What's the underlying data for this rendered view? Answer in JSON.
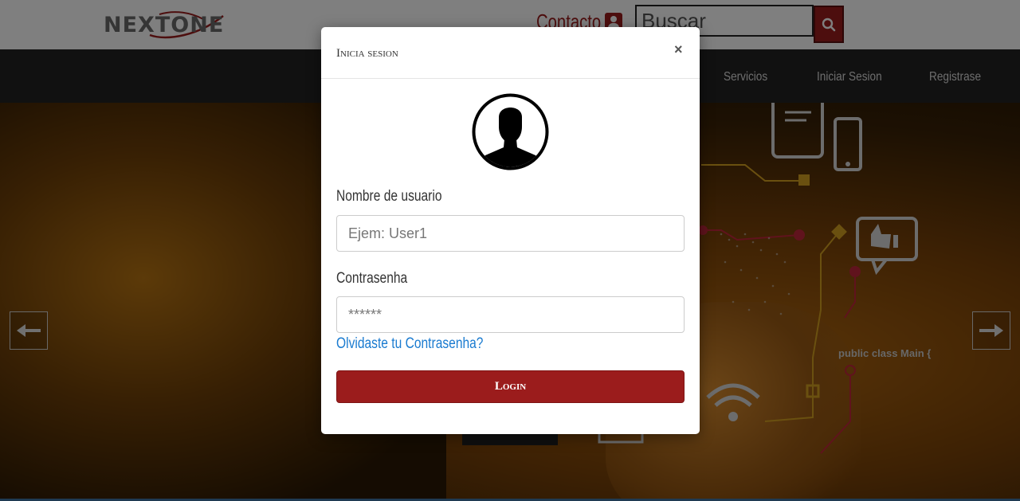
{
  "header": {
    "logo_text": "NEXTONE",
    "contact_label": "Contacto",
    "search_placeholder": "Buscar"
  },
  "nav": {
    "items": [
      "Servicios",
      "Iniciar Sesion",
      "Registrase"
    ]
  },
  "hero": {
    "code_text": "public class Main {"
  },
  "modal": {
    "title": "Inicia sesion",
    "close_label": "×",
    "username_label": "Nombre de usuario",
    "username_placeholder": "Ejem: User1",
    "password_label": "Contrasenha",
    "password_placeholder": "******",
    "forgot_link": "Olvidaste tu Contrasenha?",
    "login_button": "Login"
  },
  "colors": {
    "brand_red": "#9b1c1c",
    "link_blue": "#1a7bd0",
    "nav_bg": "#232323"
  },
  "icons": [
    "user-avatar-icon",
    "search-icon",
    "contact-icon",
    "arrow-left-icon",
    "arrow-right-icon"
  ]
}
